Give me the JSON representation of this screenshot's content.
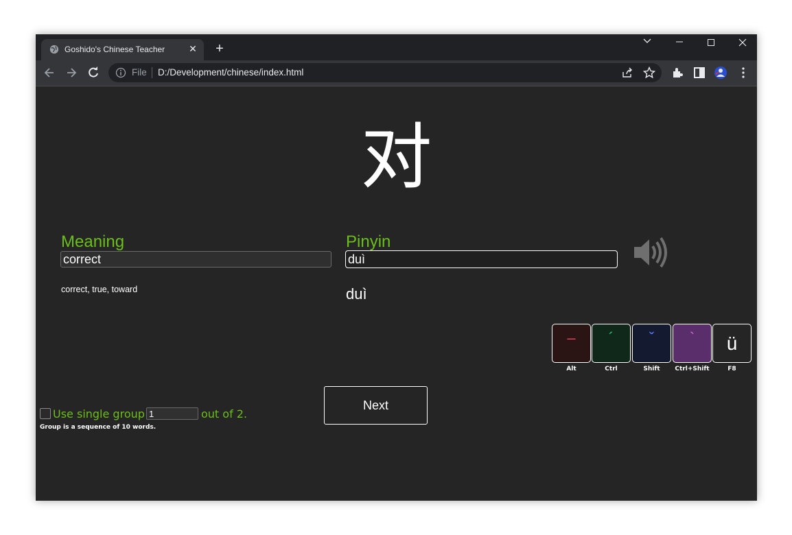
{
  "browser": {
    "tab_title": "Goshido's Chinese Teacher",
    "url_scheme_label": "File",
    "url": "D:/Development/chinese/index.html"
  },
  "card": {
    "character": "对",
    "meaning_label": "Meaning",
    "meaning_value": "correct",
    "meaning_answer": "correct, true, toward",
    "pinyin_label": "Pinyin",
    "pinyin_value": "duì",
    "pinyin_answer": "duì"
  },
  "tone_keys": [
    {
      "glyph": "–",
      "shortcut": "Alt",
      "color": "#e0405a",
      "bg": "#2a1414"
    },
    {
      "glyph": "´",
      "shortcut": "Ctrl",
      "color": "#2ecc71",
      "bg": "#10281a"
    },
    {
      "glyph": "ˇ",
      "shortcut": "Shift",
      "color": "#5a7cff",
      "bg": "#141a30"
    },
    {
      "glyph": "`",
      "shortcut": "Ctrl+Shift",
      "color": "#d070e0",
      "bg": "#5a2e6a"
    },
    {
      "glyph": "ü",
      "shortcut": "F8",
      "color": "#ffffff",
      "bg": "#252525"
    }
  ],
  "controls": {
    "next_label": "Next",
    "group_prefix": "Use single group #",
    "group_value": "1",
    "group_suffix": "out of 2.",
    "group_note": "Group is a sequence of 10 words."
  },
  "colors": {
    "accent": "#6bbf1a",
    "background": "#252525"
  }
}
